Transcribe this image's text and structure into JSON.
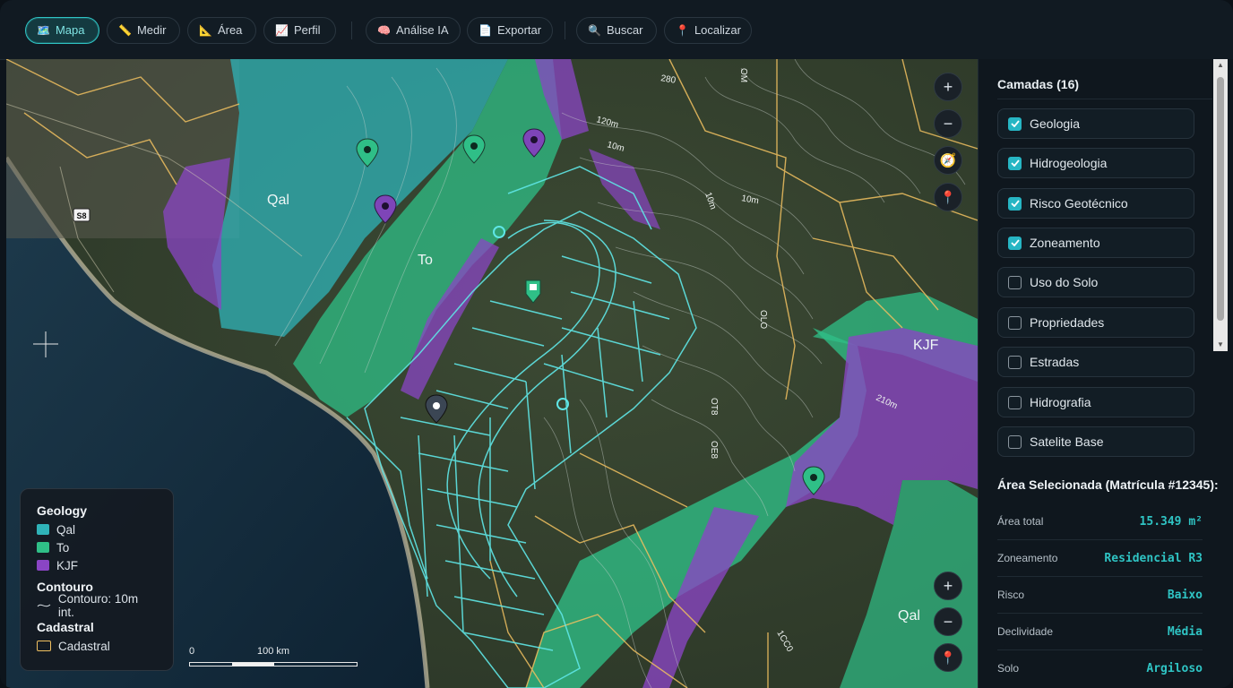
{
  "toolbar": {
    "buttons": [
      {
        "label": "Mapa",
        "icon": "🗺️",
        "active": true
      },
      {
        "label": "Medir",
        "icon": "📏"
      },
      {
        "label": "Área",
        "icon": "📐"
      },
      {
        "label": "Perfil",
        "icon": "📈"
      },
      {
        "label": "Análise IA",
        "icon": "🧠"
      },
      {
        "label": "Exportar",
        "icon": "📄"
      },
      {
        "label": "Buscar",
        "icon": "🔍"
      },
      {
        "label": "Localizar",
        "icon": "📍"
      }
    ]
  },
  "map": {
    "labels": {
      "qal_1": "Qal",
      "to": "To",
      "kjf": "KJF",
      "qal_2": "Qal",
      "route": "S8"
    },
    "contour_labels": [
      "120m",
      "10m",
      "280",
      "10m",
      "10m",
      "OM",
      "210m",
      "1CC0",
      "OLO",
      "OT8",
      "OE8"
    ],
    "controls": {
      "zoom_in": "+",
      "zoom_out": "−"
    }
  },
  "legend": {
    "geology_title": "Geology",
    "geology_items": [
      {
        "label": "Qal",
        "color": "#2fb3b8"
      },
      {
        "label": "To",
        "color": "#2fbf87"
      },
      {
        "label": "KJF",
        "color": "#8a45c4"
      }
    ],
    "contour_title": "Contouro",
    "contour_item": "Contouro: 10m int.",
    "cadastral_title": "Cadastral",
    "cadastral_item": "Cadastral"
  },
  "scale": {
    "start": "0",
    "end": "100 km"
  },
  "panel": {
    "layers_title": "Camadas (16)",
    "layers": [
      {
        "label": "Geologia",
        "checked": true
      },
      {
        "label": "Hidrogeologia",
        "checked": true
      },
      {
        "label": "Risco Geotécnico",
        "checked": true
      },
      {
        "label": "Zoneamento",
        "checked": true
      },
      {
        "label": "Uso do Solo",
        "checked": false
      },
      {
        "label": "Propriedades",
        "checked": false
      },
      {
        "label": "Estradas",
        "checked": false
      },
      {
        "label": "Hidrografia",
        "checked": false
      },
      {
        "label": "Satelite Base",
        "checked": false
      }
    ],
    "selected_title": "Área Selecionada (Matrícula #12345):",
    "info": [
      {
        "key": "Área total",
        "value": "15.349 m²"
      },
      {
        "key": "Zoneamento",
        "value": "Residencial R3"
      },
      {
        "key": "Risco",
        "value": "Baixo"
      },
      {
        "key": "Declividade",
        "value": "Média"
      },
      {
        "key": "Solo",
        "value": "Argiloso"
      }
    ]
  },
  "colors": {
    "accent": "#2fc4c4",
    "qal": "#2fb3b8",
    "to": "#2fbf87",
    "kjf": "#8a45c4",
    "cadastral": "#f0c060",
    "parcels": "#5fe6e6"
  }
}
